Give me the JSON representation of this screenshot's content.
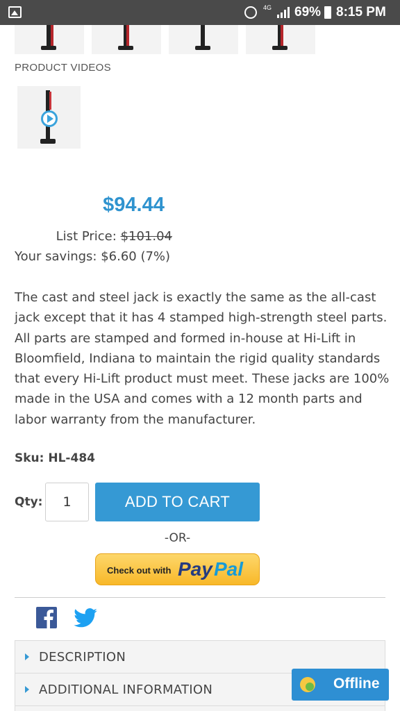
{
  "status_bar": {
    "battery_text": "69%",
    "time": "8:15 PM",
    "network_label": "4G"
  },
  "product_videos": {
    "label": "PRODUCT VIDEOS"
  },
  "pricing": {
    "price": "$94.44",
    "list_price_label": "List Price:",
    "list_price_value": "$101.04",
    "savings_text": "Your savings: $6.60 (7%)"
  },
  "description": "The cast and steel jack is exactly the same as the all-cast jack except that it has 4 stamped high-strength steel parts. All parts are stamped and formed in-house at Hi-Lift in Bloomfield, Indiana to maintain the rigid quality standards that every Hi-Lift product must meet. These jacks are 100% made in the USA and comes with a 12 month parts and labor warranty from the manufacturer.",
  "sku": {
    "label": "Sku:",
    "value": "HL-484"
  },
  "cart": {
    "qty_label": "Qty:",
    "qty_value": "1",
    "add_to_cart_label": "ADD TO CART",
    "or_label": "-OR-",
    "paypal_small": "Check out with",
    "paypal_pay": "Pay",
    "paypal_pal": "Pal"
  },
  "accordion": [
    {
      "label": "DESCRIPTION"
    },
    {
      "label": "ADDITIONAL INFORMATION"
    }
  ],
  "chat": {
    "status": "Offline"
  },
  "colors": {
    "accent": "#3599d4",
    "price": "#2f93cf",
    "facebook": "#3b5998",
    "twitter": "#1da1f2",
    "paypal_gold": "#f8b829"
  }
}
